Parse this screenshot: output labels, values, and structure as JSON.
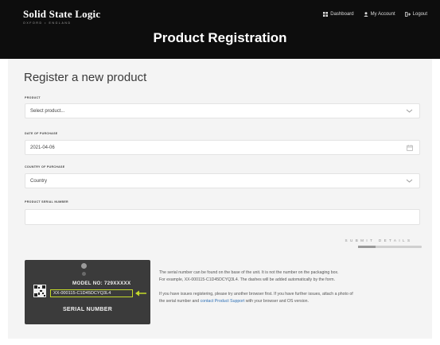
{
  "header": {
    "brand": "Solid State Logic",
    "brand_sub": "OXFORD • ENGLAND",
    "title": "Product Registration",
    "nav": [
      {
        "label": "Dashboard",
        "icon": "grid-icon"
      },
      {
        "label": "My Account",
        "icon": "user-icon"
      },
      {
        "label": "Logout",
        "icon": "logout-icon"
      }
    ]
  },
  "form": {
    "heading": "Register a new product",
    "product": {
      "label": "PRODUCT",
      "value": "Select product..."
    },
    "date": {
      "label": "DATE OF PURCHASE",
      "value": "2021-04-06"
    },
    "country": {
      "label": "COUNTRY OF PURCHASE",
      "value": "Country"
    },
    "serial": {
      "label": "PRODUCT SERIAL NUMBER",
      "value": ""
    },
    "submit": "SUBMIT DETAILS",
    "submit_progress": 0.27
  },
  "serial_image": {
    "model_no": "MODEL NO: 729XXXXX",
    "serial": "XX-000115-C1D45DCYQ3L4",
    "caption": "SERIAL NUMBER"
  },
  "help": {
    "line1": "The serial number can be found on the base of the unit. It is not the number on the packaging box.",
    "line2": "For example, XX-000115-C1D45DCYQ3L4. The dashes will be added automatically by the form.",
    "line3": "If you have issues registering, please try another browser first. If you have further issues, attach a photo of",
    "line4_pre": "the serial number and ",
    "line4_link": "contact Product Support",
    "line4_post": " with your browser and OS version."
  },
  "colors": {
    "header_bg": "#0d0d0d",
    "page_bg": "#f4f4f4",
    "link": "#2c6fb5",
    "highlight": "#c4d92b"
  }
}
